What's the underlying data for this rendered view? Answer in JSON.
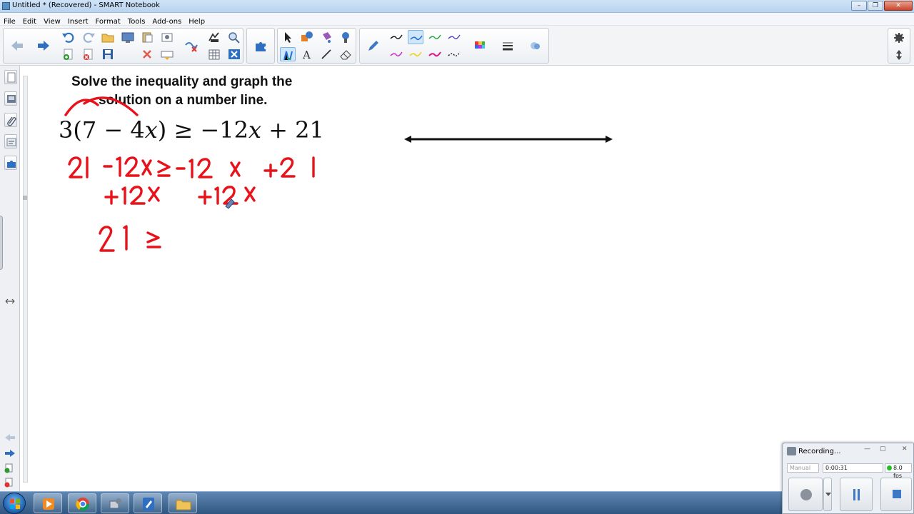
{
  "window": {
    "title": "Untitled * (Recovered) - SMART Notebook",
    "minimize": "–",
    "restore": "❐",
    "close": "✕"
  },
  "menu": [
    "File",
    "Edit",
    "View",
    "Insert",
    "Format",
    "Tools",
    "Add-ons",
    "Help"
  ],
  "toolbar": {
    "icons": [
      "back-arrow",
      "forward-arrow",
      "undo",
      "redo",
      "open-file",
      "screen-shade",
      "paste",
      "capture",
      "clear-page",
      "save",
      "delete",
      "table",
      "select",
      "pen",
      "text",
      "line",
      "eraser",
      "color-palette",
      "properties"
    ],
    "active_pen_color": "#2a6fd6"
  },
  "canvas": {
    "prompt_line1": "Solve the inequality and graph the",
    "prompt_line2": "solution on a number line.",
    "equation": {
      "lhs_coef": "3(7 − 4",
      "lhs_var": "x",
      "lhs_close": ")",
      "op": "≥",
      "rhs_coef": "−12",
      "rhs_var": "x",
      "rhs_rest": "+ 21"
    },
    "ink_color": "#e8121b",
    "handwriting_lines": [
      "21 -12x ≥ -12 x +21",
      "+12x      +12x",
      "21 ≥"
    ]
  },
  "recorder": {
    "title": "Recording...",
    "elapsed": "0:00:31",
    "fps": "8.0 fps",
    "mode": "Manual",
    "minimize": "—",
    "restore": "▢",
    "close": "✕"
  }
}
